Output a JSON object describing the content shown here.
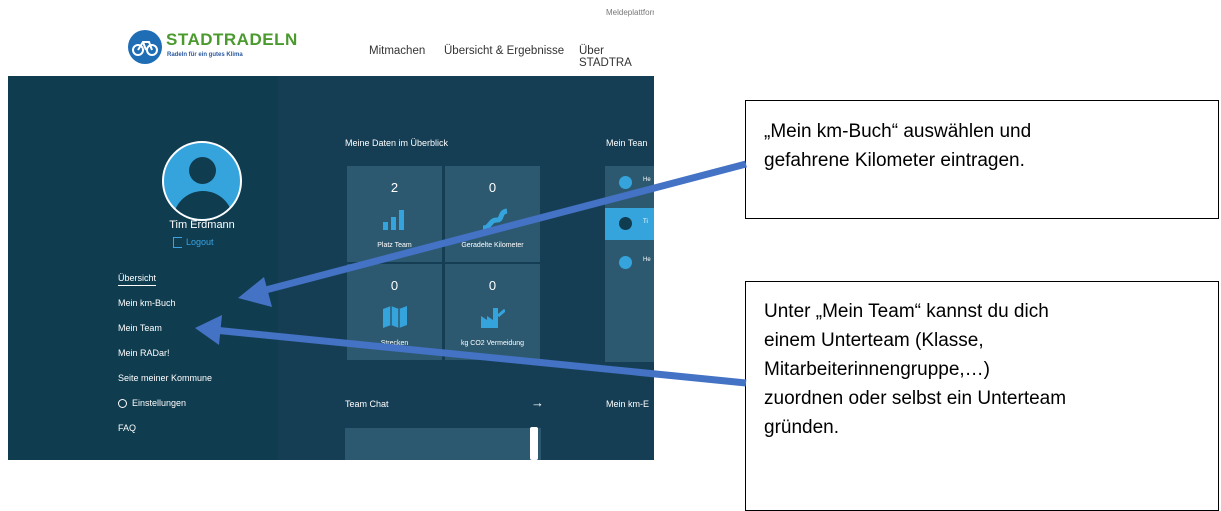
{
  "colors": {
    "sidebar": "#0f3c4f",
    "dashboard": "#153e55",
    "tile": "#2d5970",
    "accent": "#35a4dd",
    "logo_green": "#4a9a2e",
    "logo_blue": "#1e6db5",
    "arrow": "#4472c4"
  },
  "header": {
    "topline": "Meldeplattform",
    "logo_title": "STADTRADELN",
    "logo_subtitle": "Radeln für ein gutes Klima",
    "nav": [
      "Mitmachen",
      "Übersicht & Ergebnisse",
      "Über STADTRA"
    ]
  },
  "profile": {
    "name": "Tim Erdmann",
    "logout": "Logout"
  },
  "sidebar": {
    "items": [
      {
        "label": "Übersicht"
      },
      {
        "label": "Mein km-Buch"
      },
      {
        "label": "Mein Team"
      },
      {
        "label": "Mein RADar!"
      },
      {
        "label": "Seite meiner Kommune"
      },
      {
        "label": "Einstellungen",
        "icon": "gear-icon"
      },
      {
        "label": "FAQ"
      }
    ]
  },
  "overview": {
    "title": "Meine Daten im Überblick",
    "tiles": [
      {
        "value": "2",
        "label": "Platz Team",
        "icon": "bar-chart-icon"
      },
      {
        "value": "0",
        "label": "Geradelte Kilometer",
        "icon": "road-icon"
      },
      {
        "value": "0",
        "label": "Strecken",
        "icon": "map-icon"
      },
      {
        "value": "0",
        "label": "kg CO2 Vermeidung",
        "icon": "factory-icon"
      }
    ]
  },
  "team": {
    "title": "Mein Tean",
    "members": [
      {
        "text": "He"
      },
      {
        "text": "Ti"
      },
      {
        "text": "He"
      }
    ]
  },
  "chat": {
    "title": "Team Chat",
    "arrow": "→"
  },
  "kmbuch_panel": {
    "title": "Mein km-E"
  },
  "callouts": {
    "first": [
      "„Mein km-Buch“ auswählen und",
      "gefahrene Kilometer eintragen."
    ],
    "second": [
      "Unter „Mein Team“ kannst du dich",
      "einem Unterteam (Klasse,",
      "Mitarbeiterinnengruppe,…)",
      "zuordnen oder selbst ein Unterteam",
      "gründen."
    ]
  }
}
